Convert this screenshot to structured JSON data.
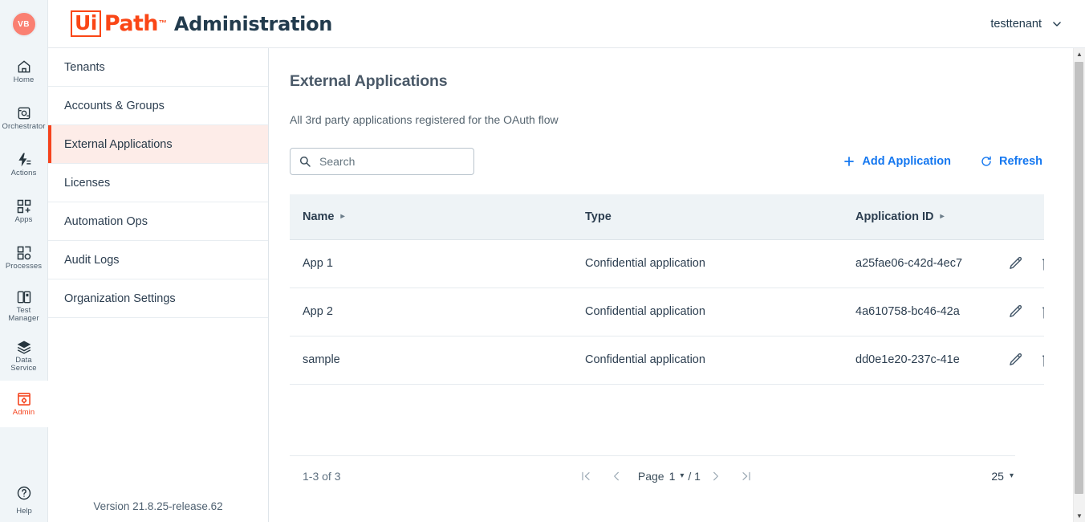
{
  "colors": {
    "brand_orange": "#fa4616",
    "accent_blue": "#1477f0",
    "active_nav_bg": "#fdece8",
    "active_nav_bar": "#f5431d",
    "rail_bg": "#f0f5f8",
    "table_header_bg": "#eef3f6",
    "avatar_bg": "#fa8072",
    "text_primary": "#2c3e50"
  },
  "header": {
    "avatar_initials": "VB",
    "brand_ui": "Ui",
    "brand_path": "Path",
    "brand_tm": "™",
    "brand_product": "Administration",
    "tenant_name": "testtenant"
  },
  "rail": {
    "items": [
      {
        "label": "Home",
        "icon": "home-icon",
        "active": false
      },
      {
        "label": "Orchestrator",
        "icon": "orchestrator-icon",
        "active": false
      },
      {
        "label": "Actions",
        "icon": "actions-icon",
        "active": false
      },
      {
        "label": "Apps",
        "icon": "apps-icon",
        "active": false
      },
      {
        "label": "Processes",
        "icon": "processes-icon",
        "active": false
      },
      {
        "label": "Test\nManager",
        "icon": "test-manager-icon",
        "active": false
      },
      {
        "label": "Data\nService",
        "icon": "data-service-icon",
        "active": false
      },
      {
        "label": "Admin",
        "icon": "admin-icon",
        "active": true
      }
    ],
    "help_label": "Help",
    "help_icon": "help-circle-icon"
  },
  "submenu": {
    "items": [
      {
        "label": "Tenants",
        "active": false
      },
      {
        "label": "Accounts & Groups",
        "active": false
      },
      {
        "label": "External Applications",
        "active": true
      },
      {
        "label": "Licenses",
        "active": false
      },
      {
        "label": "Automation Ops",
        "active": false
      },
      {
        "label": "Audit Logs",
        "active": false
      },
      {
        "label": "Organization Settings",
        "active": false
      }
    ],
    "version": "Version 21.8.25-release.62"
  },
  "main": {
    "title": "External Applications",
    "subtitle": "All 3rd party applications registered for the OAuth flow",
    "search": {
      "value": "",
      "placeholder": "Search",
      "icon": "search-icon"
    },
    "add_button": {
      "label": "Add Application",
      "icon": "plus-icon"
    },
    "refresh_button": {
      "label": "Refresh",
      "icon": "refresh-icon"
    }
  },
  "table": {
    "columns": [
      {
        "label": "Name",
        "sortable": true
      },
      {
        "label": "Type",
        "sortable": false
      },
      {
        "label": "Application ID",
        "sortable": true
      },
      {
        "label": "",
        "sortable": false
      }
    ],
    "rows": [
      {
        "name": "App 1",
        "type": "Confidential application",
        "app_id": "a25fae06-c42d-4ec7",
        "edit_icon": "pencil-icon",
        "delete_icon": "trash-x-icon"
      },
      {
        "name": "App 2",
        "type": "Confidential application",
        "app_id": "4a610758-bc46-42a",
        "edit_icon": "pencil-icon",
        "delete_icon": "trash-x-icon"
      },
      {
        "name": "sample",
        "type": "Confidential application",
        "app_id": "dd0e1e20-237c-41e",
        "edit_icon": "pencil-icon",
        "delete_icon": "trash-x-icon"
      }
    ]
  },
  "pagination": {
    "range_text": "1-3 of 3",
    "first_icon": "first-page-icon",
    "prev_icon": "prev-page-icon",
    "page_label": "Page",
    "current_page": "1",
    "separator": "/ 1",
    "next_icon": "next-page-icon",
    "last_icon": "last-page-icon",
    "page_size": "25"
  }
}
